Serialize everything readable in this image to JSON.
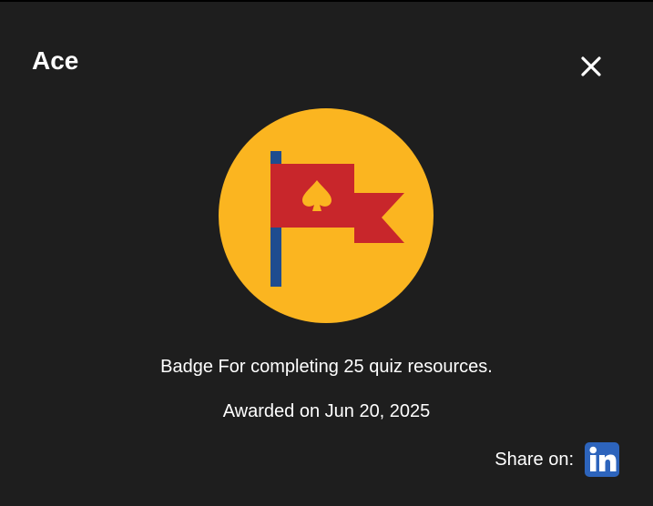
{
  "dialog": {
    "title": "Ace",
    "description": "Badge For completing 25 quiz resources.",
    "awarded": "Awarded on Jun 20, 2025",
    "share_label": "Share on:",
    "icons": {
      "close": "close-icon",
      "badge": "flag-badge-icon",
      "share": "linkedin-icon"
    }
  },
  "colors": {
    "background": "#1e1e1e",
    "text": "#ffffff",
    "badge_circle": "#fbb520",
    "flag": "#c8262b",
    "pole": "#1f4c8f",
    "spade": "#fbb520",
    "linkedin": "#2d64bc"
  }
}
